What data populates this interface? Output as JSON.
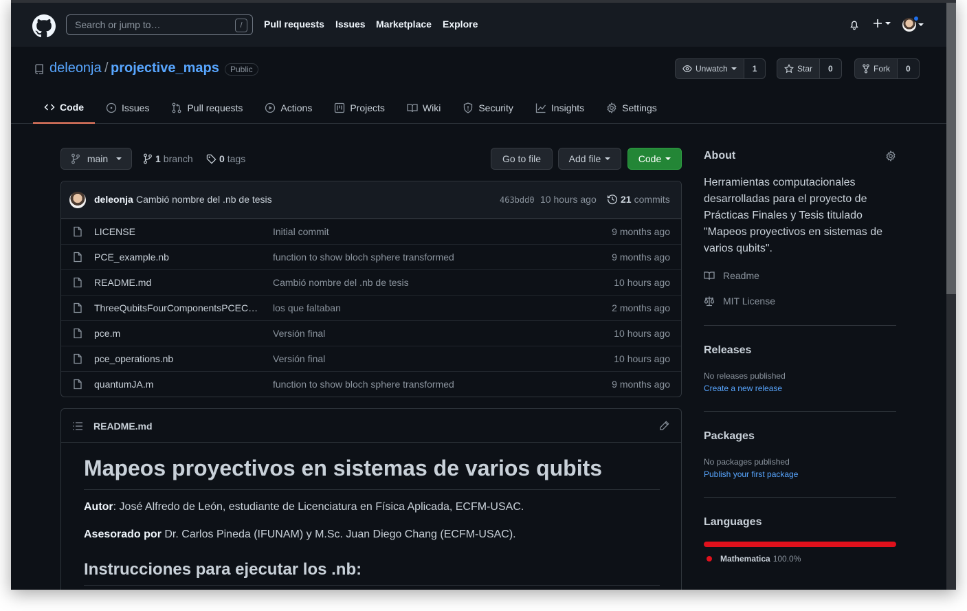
{
  "topbar": {
    "search_placeholder": "Search or jump to…",
    "search_shortcut": "/",
    "nav": [
      "Pull requests",
      "Issues",
      "Marketplace",
      "Explore"
    ]
  },
  "repo": {
    "owner": "deleonja",
    "separator": "/",
    "name": "projective_maps",
    "visibility": "Public",
    "watch_label": "Unwatch",
    "watch_count": "1",
    "star_label": "Star",
    "star_count": "0",
    "fork_label": "Fork",
    "fork_count": "0"
  },
  "tabs": [
    {
      "label": "Code",
      "icon": "code-icon"
    },
    {
      "label": "Issues",
      "icon": "issue-icon"
    },
    {
      "label": "Pull requests",
      "icon": "pull-request-icon"
    },
    {
      "label": "Actions",
      "icon": "play-icon"
    },
    {
      "label": "Projects",
      "icon": "project-icon"
    },
    {
      "label": "Wiki",
      "icon": "book-icon"
    },
    {
      "label": "Security",
      "icon": "shield-icon"
    },
    {
      "label": "Insights",
      "icon": "graph-icon"
    },
    {
      "label": "Settings",
      "icon": "gear-icon"
    }
  ],
  "toolbar": {
    "branch": "main",
    "branch_count": "1",
    "branch_word": "branch",
    "tag_count": "0",
    "tag_word": "tags",
    "go_to_file": "Go to file",
    "add_file": "Add file",
    "code": "Code"
  },
  "commit": {
    "author": "deleonja",
    "message": "Cambió nombre del .nb de tesis",
    "sha": "463bdd0",
    "age": "10 hours ago",
    "count": "21",
    "count_word": "commits"
  },
  "files": [
    {
      "name": "LICENSE",
      "message": "Initial commit",
      "age": "9 months ago"
    },
    {
      "name": "PCE_example.nb",
      "message": "function to show bloch sphere transformed",
      "age": "9 months ago"
    },
    {
      "name": "README.md",
      "message": "Cambió nombre del .nb de tesis",
      "age": "10 hours ago"
    },
    {
      "name": "ThreeQubitsFourComponentsPCEC…",
      "message": "los que faltaban",
      "age": "2 months ago"
    },
    {
      "name": "pce.m",
      "message": "Versión final",
      "age": "10 hours ago"
    },
    {
      "name": "pce_operations.nb",
      "message": "Versión final",
      "age": "10 hours ago"
    },
    {
      "name": "quantumJA.m",
      "message": "function to show bloch sphere transformed",
      "age": "9 months ago"
    }
  ],
  "readme": {
    "filename": "README.md",
    "title": "Mapeos proyectivos en sistemas de varios qubits",
    "author_label": "Autor",
    "author_text": ": José Alfredo de León, estudiante de Licenciatura en Física Aplicada, ECFM-USAC.",
    "advisor_label": "Asesorado por",
    "advisor_text": " Dr. Carlos Pineda (IFUNAM) y M.Sc. Juan Diego Chang (ECFM-USAC).",
    "subtitle": "Instrucciones para ejecutar los .nb:"
  },
  "sidebar": {
    "about_title": "About",
    "description": "Herramientas computacionales desarrolladas para el proyecto de Prácticas Finales y Tesis titulado \"Mapeos proyectivos en sistemas de varios qubits\".",
    "readme_link": "Readme",
    "license_link": "MIT License",
    "releases_title": "Releases",
    "releases_none": "No releases published",
    "releases_create": "Create a new release",
    "packages_title": "Packages",
    "packages_none": "No packages published",
    "packages_publish": "Publish your first package",
    "languages_title": "Languages",
    "language_name": "Mathematica",
    "language_percent": "100.0%",
    "language_fraction": 1.0,
    "language_color": "#e0111c"
  }
}
